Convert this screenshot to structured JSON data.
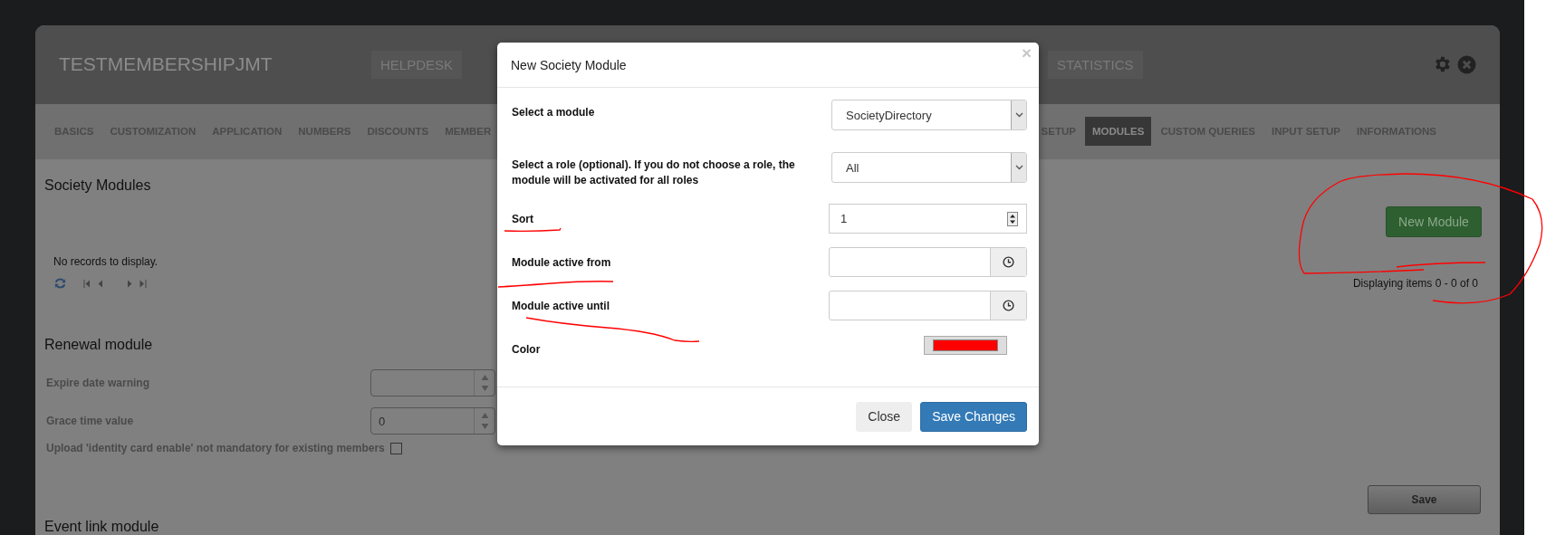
{
  "header": {
    "title": "TESTMEMBERSHIPJMT",
    "menu": [
      {
        "label": "HELPDESK"
      },
      {
        "label": "STATISTICS"
      }
    ]
  },
  "tabs": [
    {
      "label": "BASICS",
      "selected": false
    },
    {
      "label": "CUSTOMIZATION",
      "selected": false
    },
    {
      "label": "APPLICATION",
      "selected": false
    },
    {
      "label": "NUMBERS",
      "selected": false
    },
    {
      "label": "DISCOUNTS",
      "selected": false
    },
    {
      "label": "MEMBER",
      "selected": false
    },
    {
      "label": "SETUP",
      "selected": false
    },
    {
      "label": "MODULES",
      "selected": true
    },
    {
      "label": "CUSTOM QUERIES",
      "selected": false
    },
    {
      "label": "INPUT SETUP",
      "selected": false
    },
    {
      "label": "INFORMATIONS",
      "selected": false
    }
  ],
  "society_modules": {
    "title": "Society Modules",
    "new_button": "New Module",
    "empty_text": "No records to display.",
    "pager_info": "Displaying items 0 - 0 of 0"
  },
  "renewal_module": {
    "title": "Renewal module",
    "fields": [
      {
        "kind": "spinner",
        "label": "Expire date warning"
      },
      {
        "kind": "spinner",
        "label": "Grace time value",
        "value": "0"
      },
      {
        "kind": "checkbox",
        "label": "Upload 'identity card enable' not mandatory for existing members",
        "checked": false
      }
    ]
  },
  "save_button": "Save",
  "event_link_module": {
    "title": "Event link module"
  },
  "modal": {
    "title": "New Society Module",
    "close_symbol": "×",
    "fields": [
      {
        "kind": "select",
        "label": "Select a module",
        "value": "SocietyDirectory"
      },
      {
        "kind": "select",
        "label": "Select a role (optional). If you do not choose a role, the module will be activated for all roles",
        "value": "All"
      },
      {
        "kind": "number",
        "label": "Sort",
        "value": "1"
      },
      {
        "kind": "time",
        "label": "Module active from"
      },
      {
        "kind": "time",
        "label": "Module active until"
      },
      {
        "kind": "color",
        "label": "Color",
        "color": "#ff0000"
      }
    ],
    "buttons": [
      {
        "label": "Close",
        "kind": "default"
      },
      {
        "label": "Save Changes",
        "kind": "primary"
      }
    ]
  }
}
